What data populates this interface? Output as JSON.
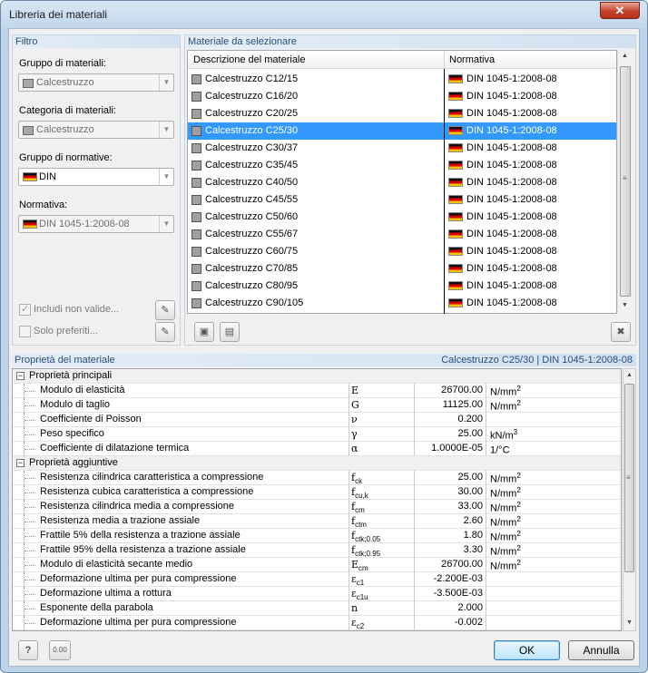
{
  "window": {
    "title": "Libreria dei materiali",
    "close": "✕"
  },
  "filter": {
    "title": "Filtro",
    "group_label": "Gruppo di materiali:",
    "group_value": "Calcestruzzo",
    "category_label": "Categoria di materiali:",
    "category_value": "Calcestruzzo",
    "norm_group_label": "Gruppo di normative:",
    "norm_group_value": "DIN",
    "norm_label": "Normativa:",
    "norm_value": "DIN 1045-1:2008-08",
    "include_invalid": "Includi non valide...",
    "favorites": "Solo preferiti..."
  },
  "materials": {
    "title": "Materiale da selezionare",
    "col_desc": "Descrizione del materiale",
    "col_norm": "Normativa",
    "rows": [
      {
        "name": "Calcestruzzo C12/15",
        "norm": "DIN 1045-1:2008-08"
      },
      {
        "name": "Calcestruzzo C16/20",
        "norm": "DIN 1045-1:2008-08"
      },
      {
        "name": "Calcestruzzo C20/25",
        "norm": "DIN 1045-1:2008-08"
      },
      {
        "name": "Calcestruzzo C25/30",
        "norm": "DIN 1045-1:2008-08"
      },
      {
        "name": "Calcestruzzo C30/37",
        "norm": "DIN 1045-1:2008-08"
      },
      {
        "name": "Calcestruzzo C35/45",
        "norm": "DIN 1045-1:2008-08"
      },
      {
        "name": "Calcestruzzo C40/50",
        "norm": "DIN 1045-1:2008-08"
      },
      {
        "name": "Calcestruzzo C45/55",
        "norm": "DIN 1045-1:2008-08"
      },
      {
        "name": "Calcestruzzo C50/60",
        "norm": "DIN 1045-1:2008-08"
      },
      {
        "name": "Calcestruzzo C55/67",
        "norm": "DIN 1045-1:2008-08"
      },
      {
        "name": "Calcestruzzo C60/75",
        "norm": "DIN 1045-1:2008-08"
      },
      {
        "name": "Calcestruzzo C70/85",
        "norm": "DIN 1045-1:2008-08"
      },
      {
        "name": "Calcestruzzo C80/95",
        "norm": "DIN 1045-1:2008-08"
      },
      {
        "name": "Calcestruzzo C90/105",
        "norm": "DIN 1045-1:2008-08"
      }
    ],
    "selected_index": 3
  },
  "properties": {
    "title": "Proprietà del materiale",
    "selected_summary": "Calcestruzzo C25/30  |  DIN 1045-1:2008-08",
    "groups": [
      {
        "name": "Proprietà principali",
        "rows": [
          {
            "name": "Modulo di elasticità",
            "symbol": "E",
            "sub": "",
            "value": "26700.00",
            "unit": "N/mm",
            "unit_exp": "2"
          },
          {
            "name": "Modulo di taglio",
            "symbol": "G",
            "sub": "",
            "value": "11125.00",
            "unit": "N/mm",
            "unit_exp": "2"
          },
          {
            "name": "Coefficiente di Poisson",
            "symbol": "ν",
            "sub": "",
            "value": "0.200",
            "unit": "",
            "unit_exp": ""
          },
          {
            "name": "Peso specifico",
            "symbol": "γ",
            "sub": "",
            "value": "25.00",
            "unit": "kN/m",
            "unit_exp": "3"
          },
          {
            "name": "Coefficiente di dilatazione termica",
            "symbol": "α",
            "sub": "",
            "value": "1.0000E-05",
            "unit": "1/°C",
            "unit_exp": ""
          }
        ]
      },
      {
        "name": "Proprietà aggiuntive",
        "rows": [
          {
            "name": "Resistenza cilindrica caratteristica a compressione",
            "symbol": "f",
            "sub": "ck",
            "value": "25.00",
            "unit": "N/mm",
            "unit_exp": "2"
          },
          {
            "name": "Resistenza cubica caratteristica a compressione",
            "symbol": "f",
            "sub": "cu,k",
            "value": "30.00",
            "unit": "N/mm",
            "unit_exp": "2"
          },
          {
            "name": "Resistenza cilindrica media a compressione",
            "symbol": "f",
            "sub": "cm",
            "value": "33.00",
            "unit": "N/mm",
            "unit_exp": "2"
          },
          {
            "name": "Resistenza media a trazione assiale",
            "symbol": "f",
            "sub": "ctm",
            "value": "2.60",
            "unit": "N/mm",
            "unit_exp": "2"
          },
          {
            "name": "Frattile 5% della resistenza a trazione assiale",
            "symbol": "f",
            "sub": "ctk;0.05",
            "value": "1.80",
            "unit": "N/mm",
            "unit_exp": "2"
          },
          {
            "name": "Frattile 95% della resistenza a trazione assiale",
            "symbol": "f",
            "sub": "ctk;0.95",
            "value": "3.30",
            "unit": "N/mm",
            "unit_exp": "2"
          },
          {
            "name": "Modulo di elasticità secante medio",
            "symbol": "E",
            "sub": "cm",
            "value": "26700.00",
            "unit": "N/mm",
            "unit_exp": "2"
          },
          {
            "name": "Deformazione ultima per pura compressione",
            "symbol": "ε",
            "sub": "c1",
            "value": "-2.200E-03",
            "unit": "",
            "unit_exp": ""
          },
          {
            "name": "Deformazione ultima a rottura",
            "symbol": "ε",
            "sub": "c1u",
            "value": "-3.500E-03",
            "unit": "",
            "unit_exp": ""
          },
          {
            "name": "Esponente della parabola",
            "symbol": "n",
            "sub": "",
            "value": "2.000",
            "unit": "",
            "unit_exp": ""
          },
          {
            "name": "Deformazione ultima per pura compressione",
            "symbol": "ε",
            "sub": "c2",
            "value": "-0.002",
            "unit": "",
            "unit_exp": ""
          }
        ]
      }
    ]
  },
  "buttons": {
    "ok": "OK",
    "cancel": "Annulla",
    "units": "0.00"
  }
}
